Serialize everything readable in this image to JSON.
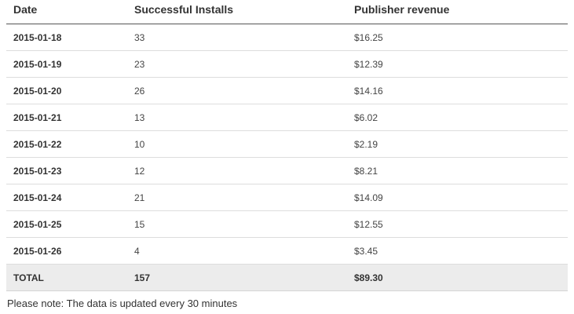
{
  "table": {
    "headers": {
      "date": "Date",
      "installs": "Successful Installs",
      "revenue": "Publisher revenue"
    },
    "rows": [
      {
        "date": "2015-01-18",
        "installs": "33",
        "revenue": "$16.25"
      },
      {
        "date": "2015-01-19",
        "installs": "23",
        "revenue": "$12.39"
      },
      {
        "date": "2015-01-20",
        "installs": "26",
        "revenue": "$14.16"
      },
      {
        "date": "2015-01-21",
        "installs": "13",
        "revenue": "$6.02"
      },
      {
        "date": "2015-01-22",
        "installs": "10",
        "revenue": "$2.19"
      },
      {
        "date": "2015-01-23",
        "installs": "12",
        "revenue": "$8.21"
      },
      {
        "date": "2015-01-24",
        "installs": "21",
        "revenue": "$14.09"
      },
      {
        "date": "2015-01-25",
        "installs": "15",
        "revenue": "$12.55"
      },
      {
        "date": "2015-01-26",
        "installs": "4",
        "revenue": "$3.45"
      }
    ],
    "total": {
      "label": "TOTAL",
      "installs": "157",
      "revenue": "$89.30"
    }
  },
  "note": "Please note: The data is updated every 30 minutes"
}
